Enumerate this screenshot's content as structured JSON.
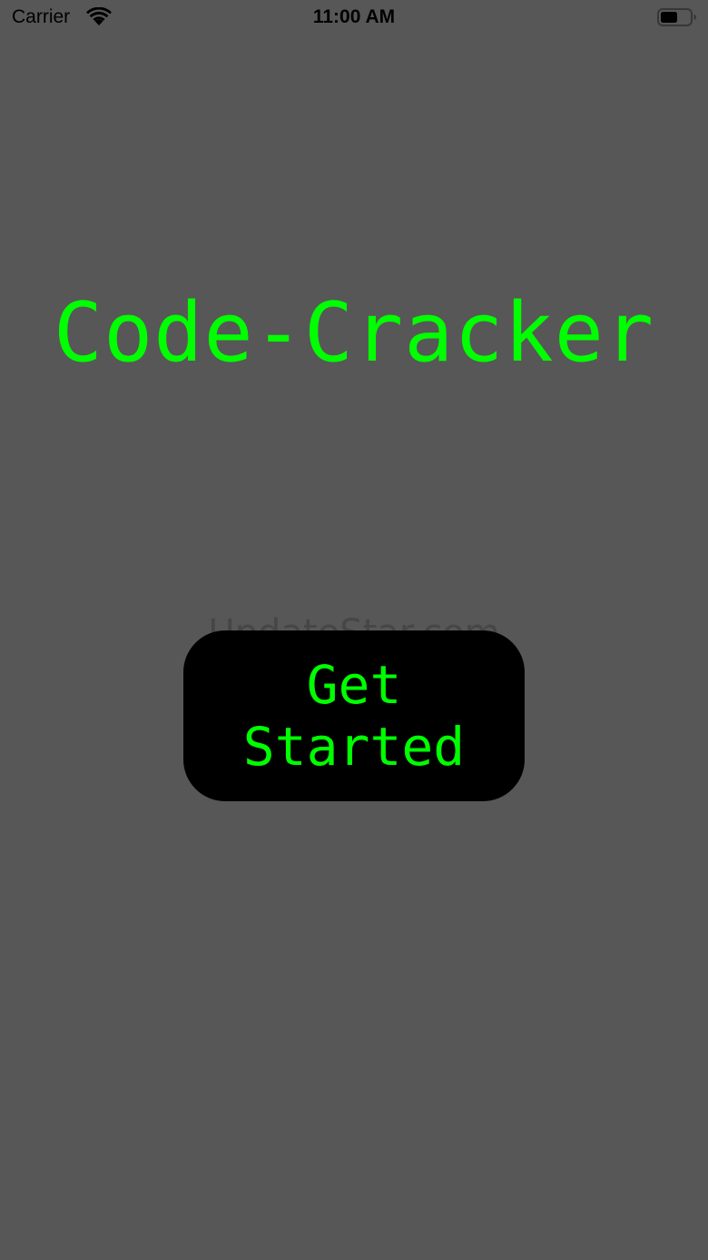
{
  "status_bar": {
    "carrier": "Carrier",
    "time": "11:00 AM",
    "wifi_icon": "wifi-icon",
    "battery_icon": "battery-icon"
  },
  "main": {
    "title": "Code-Cracker",
    "get_started_label": "Get Started"
  },
  "watermark": "UpdateStar.com",
  "colors": {
    "background": "#575757",
    "accent": "#00ff00",
    "button_background": "#000000"
  }
}
